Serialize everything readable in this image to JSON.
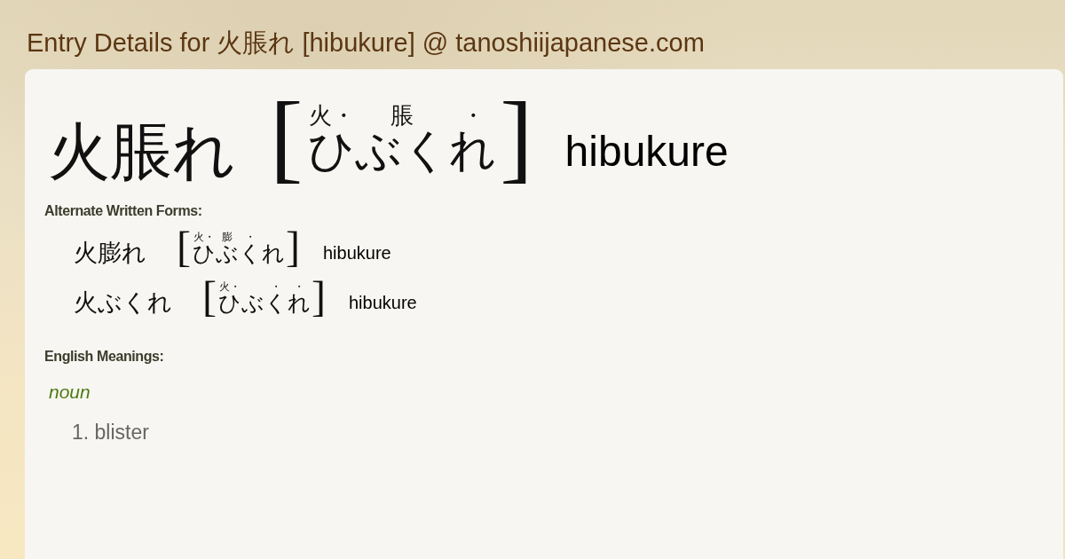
{
  "page_title": "Entry Details for 火脹れ [hibukure] @ tanoshiijapanese.com",
  "entry": {
    "headword": "火脹れ",
    "brackets": [
      "[",
      "]"
    ],
    "reading": [
      {
        "kana": "ひ",
        "kanji_mark": "火・"
      },
      {
        "kana": "ぶく",
        "kanji_mark": "脹"
      },
      {
        "kana": "れ",
        "kanji_mark": "・"
      }
    ],
    "romaji": "hibukure"
  },
  "alternate_forms": {
    "heading": "Alternate Written Forms:",
    "items": [
      {
        "headword": "火膨れ",
        "brackets": [
          "[",
          "]"
        ],
        "reading": [
          {
            "kana": "ひ",
            "kanji_mark": "火・"
          },
          {
            "kana": "ぶ",
            "kanji_mark": "膨"
          },
          {
            "kana": "く",
            "kanji_mark": "・"
          },
          {
            "kana": "れ"
          }
        ],
        "romaji": "hibukure"
      },
      {
        "headword": "火ぶくれ",
        "brackets": [
          "[",
          "]"
        ],
        "reading": [
          {
            "kana": "ひ",
            "kanji_mark": "火・"
          },
          {
            "kana": "ぶ"
          },
          {
            "kana": "く",
            "kanji_mark": "・"
          },
          {
            "kana": "れ",
            "kanji_mark": "・"
          }
        ],
        "romaji": "hibukure"
      }
    ]
  },
  "meanings": {
    "heading": "English Meanings:",
    "part_of_speech": "noun",
    "senses": [
      {
        "number": "1.",
        "text": "blister"
      }
    ]
  }
}
